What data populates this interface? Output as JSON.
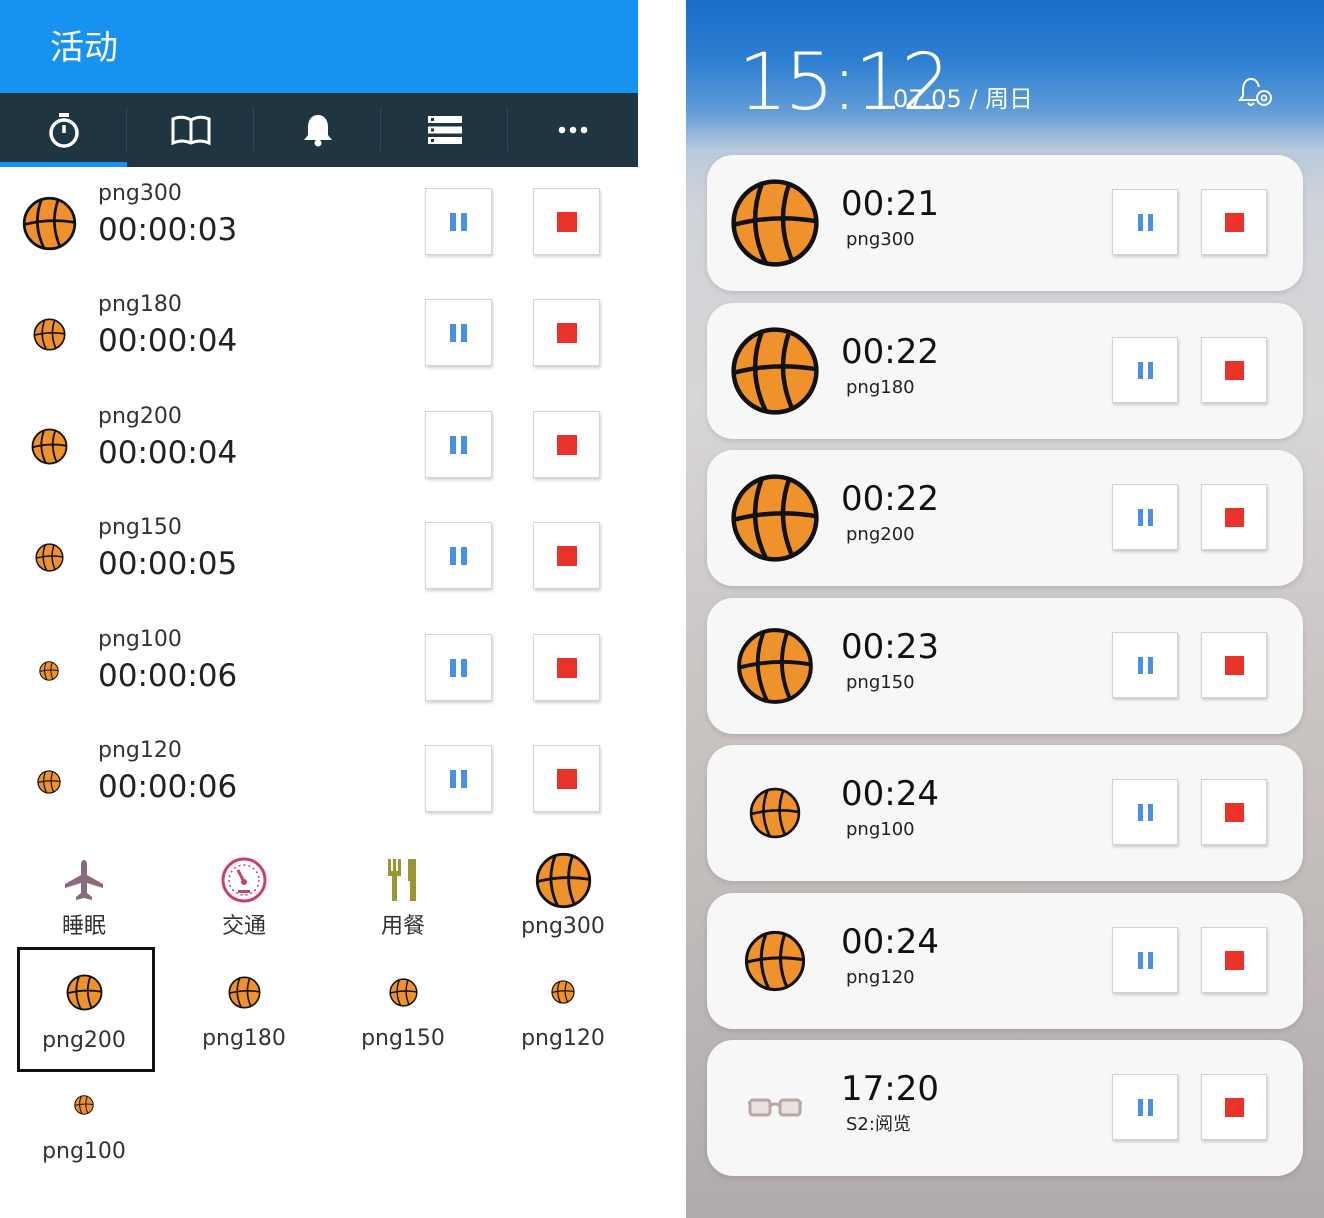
{
  "colors": {
    "appbar": "#1792f0",
    "tabbar": "#1f3542",
    "accent_pause": "#4a90e2",
    "accent_stop": "#e8322a",
    "ball": "#f0922b"
  },
  "left": {
    "appbar": {
      "title": "活动"
    },
    "tabs": [
      {
        "icon": "stopwatch-icon",
        "selected": true
      },
      {
        "icon": "book-icon",
        "selected": false
      },
      {
        "icon": "bell-icon",
        "selected": false
      },
      {
        "icon": "list-icon",
        "selected": false
      },
      {
        "icon": "more-icon",
        "selected": false
      }
    ],
    "timers": [
      {
        "name": "png300",
        "time": "00:00:03"
      },
      {
        "name": "png180",
        "time": "00:00:04"
      },
      {
        "name": "png200",
        "time": "00:00:04"
      },
      {
        "name": "png150",
        "time": "00:00:05"
      },
      {
        "name": "png100",
        "time": "00:00:06"
      },
      {
        "name": "png120",
        "time": "00:00:06"
      }
    ],
    "activities": [
      {
        "label": "睡眠",
        "icon": "airplane-icon"
      },
      {
        "label": "交通",
        "icon": "speedometer-icon"
      },
      {
        "label": "用餐",
        "icon": "fork-knife-icon"
      },
      {
        "label": "png300",
        "icon": "basketball-icon"
      },
      {
        "label": "png200",
        "icon": "basketball-icon",
        "selected": true
      },
      {
        "label": "png180",
        "icon": "basketball-icon"
      },
      {
        "label": "png150",
        "icon": "basketball-icon"
      },
      {
        "label": "png120",
        "icon": "basketball-icon"
      },
      {
        "label": "png100",
        "icon": "basketball-icon"
      }
    ]
  },
  "right": {
    "clock": "15:12",
    "date": "07.05 / 周日",
    "notifications": [
      {
        "time": "00:21",
        "name": "png300",
        "icon": "basketball-icon"
      },
      {
        "time": "00:22",
        "name": "png180",
        "icon": "basketball-icon"
      },
      {
        "time": "00:22",
        "name": "png200",
        "icon": "basketball-icon"
      },
      {
        "time": "00:23",
        "name": "png150",
        "icon": "basketball-icon"
      },
      {
        "time": "00:24",
        "name": "png100",
        "icon": "basketball-icon"
      },
      {
        "time": "00:24",
        "name": "png120",
        "icon": "basketball-icon"
      },
      {
        "time": "17:20",
        "name": "S2:阅览",
        "icon": "glasses-icon"
      }
    ]
  }
}
